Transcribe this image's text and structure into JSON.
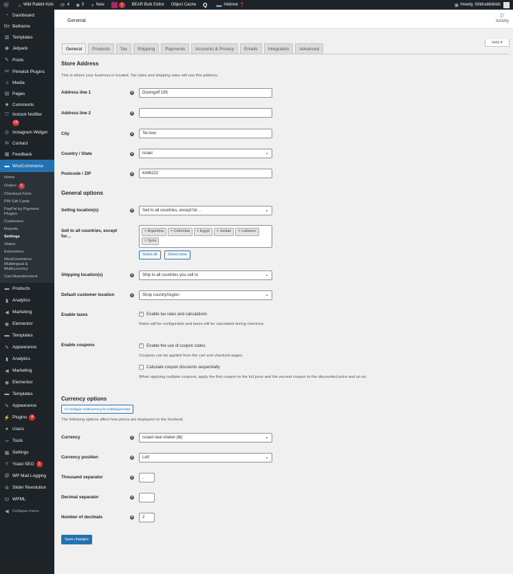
{
  "adminbar": {
    "site_name": "Wild Rabbit Kids",
    "updates_count": "4",
    "comments_count": "0",
    "new_label": "New",
    "yoast_count": "1",
    "bear_label": "BEAR Bulk Editor",
    "cache_label": "Object Cache",
    "lang_label": "Hebrew",
    "howdy": "Howdy, Wildrabbitkids"
  },
  "sidebar": {
    "items_top": [
      {
        "label": "Dashboard",
        "icon": "dashboard-icon",
        "glyph": "◔"
      },
      {
        "label": "Betheme",
        "icon": "betheme-icon",
        "glyph": "Be"
      },
      {
        "label": "Templates",
        "icon": "templates-icon",
        "glyph": "▥"
      },
      {
        "label": "Jetpack",
        "icon": "jetpack-icon",
        "glyph": "◉"
      },
      {
        "label": "Posts",
        "icon": "pin-icon",
        "glyph": "✎"
      },
      {
        "label": "Pimwick Plugins",
        "icon": "pimwick-icon",
        "glyph": "ᵖʷ"
      },
      {
        "label": "Media",
        "icon": "media-icon",
        "glyph": "♫"
      },
      {
        "label": "Pages",
        "icon": "pages-icon",
        "glyph": "▤"
      },
      {
        "label": "Comments",
        "icon": "comments-icon",
        "glyph": "■"
      },
      {
        "label": "Instock Notifier",
        "icon": "notifier-icon",
        "glyph": "⛉",
        "badge": "16"
      },
      {
        "label": "Instagram Widget",
        "icon": "instagram-icon",
        "glyph": "◎"
      },
      {
        "label": "Contact",
        "icon": "mail-icon",
        "glyph": "✉"
      },
      {
        "label": "Feedback",
        "icon": "feedback-icon",
        "glyph": "▦"
      },
      {
        "label": "WooCommerce",
        "icon": "woocommerce-icon",
        "glyph": "▬",
        "current": true
      }
    ],
    "woo_sub": [
      {
        "label": "Home"
      },
      {
        "label": "Orders",
        "badge": "5"
      },
      {
        "label": "Checkout Form"
      },
      {
        "label": "PW Gift Cards"
      },
      {
        "label": "PayPal by Payment Plugins"
      },
      {
        "label": "Customers"
      },
      {
        "label": "Reports"
      },
      {
        "label": "Settings",
        "active": true
      },
      {
        "label": "Status"
      },
      {
        "label": "Extensions"
      },
      {
        "label": "WooCommerce Multilingual & Multicurrency"
      },
      {
        "label": "Cart Abandonment"
      }
    ],
    "items_bottom": [
      {
        "label": "Products",
        "icon": "products-icon",
        "glyph": "▬"
      },
      {
        "label": "Analytics",
        "icon": "analytics-icon",
        "glyph": "▮"
      },
      {
        "label": "Marketing",
        "icon": "megaphone-icon",
        "glyph": "◀"
      },
      {
        "label": "Elementor",
        "icon": "elementor-icon",
        "glyph": "◉"
      },
      {
        "label": "Templates",
        "icon": "folder-icon",
        "glyph": "▬"
      },
      {
        "label": "Appearance",
        "icon": "brush-icon",
        "glyph": "✎"
      },
      {
        "label": "Analytics",
        "icon": "analytics-icon",
        "glyph": "▮"
      },
      {
        "label": "Marketing",
        "icon": "megaphone-icon",
        "glyph": "◀"
      },
      {
        "label": "Elementor",
        "icon": "elementor-icon",
        "glyph": "◉"
      },
      {
        "label": "Templates",
        "icon": "folder-icon",
        "glyph": "▬"
      },
      {
        "label": "Appearance",
        "icon": "brush-icon",
        "glyph": "✎"
      },
      {
        "label": "Plugins",
        "icon": "plugins-icon",
        "glyph": "⚡",
        "badge": "4"
      },
      {
        "label": "Users",
        "icon": "users-icon",
        "glyph": "●"
      },
      {
        "label": "Tools",
        "icon": "wrench-icon",
        "glyph": "✑"
      },
      {
        "label": "Settings",
        "icon": "settings-icon",
        "glyph": "▦"
      },
      {
        "label": "Yoast SEO",
        "icon": "yoast-icon",
        "glyph": "Y",
        "badge": "1"
      },
      {
        "label": "WP Mail Logging",
        "icon": "at-icon",
        "glyph": "@"
      },
      {
        "label": "Slider Revolution",
        "icon": "slider-icon",
        "glyph": "✲"
      },
      {
        "label": "WPML",
        "icon": "wpml-icon",
        "glyph": "☋"
      },
      {
        "label": "Collapse menu",
        "icon": "collapse-icon",
        "glyph": "◀"
      }
    ]
  },
  "topbar": {
    "title": "General",
    "activity": "Activity",
    "help": "Help ▾"
  },
  "tabs": [
    "General",
    "Products",
    "Tax",
    "Shipping",
    "Payments",
    "Accounts & Privacy",
    "Emails",
    "Integration",
    "Advanced"
  ],
  "store": {
    "title": "Store Address",
    "desc": "This is where your business is located. Tax rates and shipping rates will use this address.",
    "address1_label": "Address line 1",
    "address1_value": "Dizengoff 185",
    "address2_label": "Address line 2",
    "address2_value": "",
    "city_label": "City",
    "city_value": "Tel Aviv",
    "country_label": "Country / State",
    "country_value": "Israel",
    "postcode_label": "Postcode / ZIP",
    "postcode_value": "6346222"
  },
  "general": {
    "title": "General options",
    "selling_label": "Selling location(s)",
    "selling_value": "Sell to all countries, except for…",
    "except_label": "Sell to all countries, except for…",
    "except_countries": [
      "Argentina",
      "Colombia",
      "Egypt",
      "Jordan",
      "Lebanon",
      "Syria"
    ],
    "select_all": "Select all",
    "select_none": "Select none",
    "shipping_label": "Shipping location(s)",
    "shipping_value": "Ship to all countries you sell to",
    "default_cust_label": "Default customer location",
    "default_cust_value": "Shop country/region",
    "taxes_label": "Enable taxes",
    "taxes_check": "Enable tax rates and calculations",
    "taxes_desc": "Rates will be configurable and taxes will be calculated during checkout.",
    "coupons_label": "Enable coupons",
    "coupons_check": "Enable the use of coupon codes",
    "coupons_desc": "Coupons can be applied from the cart and checkout pages.",
    "seq_check": "Calculate coupon discounts sequentially",
    "seq_desc": "When applying multiple coupons, apply the first coupon to the full price and the second coupon to the discounted price and so on."
  },
  "currency": {
    "title": "Currency options",
    "configure_btn": "Configure multicurrency for multilingual sites",
    "desc": "The following options affect how prices are displayed on the frontend.",
    "currency_label": "Currency",
    "currency_value": "Israeli new shekel (₪)",
    "position_label": "Currency position",
    "position_value": "Left",
    "thousand_label": "Thousand separator",
    "thousand_value": ",",
    "decimal_label": "Decimal separator",
    "decimal_value": ".",
    "decimals_label": "Number of decimals",
    "decimals_value": "2"
  },
  "save_label": "Save changes",
  "colors": {
    "accent": "#2271b1",
    "sidebar": "#1d2327",
    "badge": "#d63638"
  }
}
